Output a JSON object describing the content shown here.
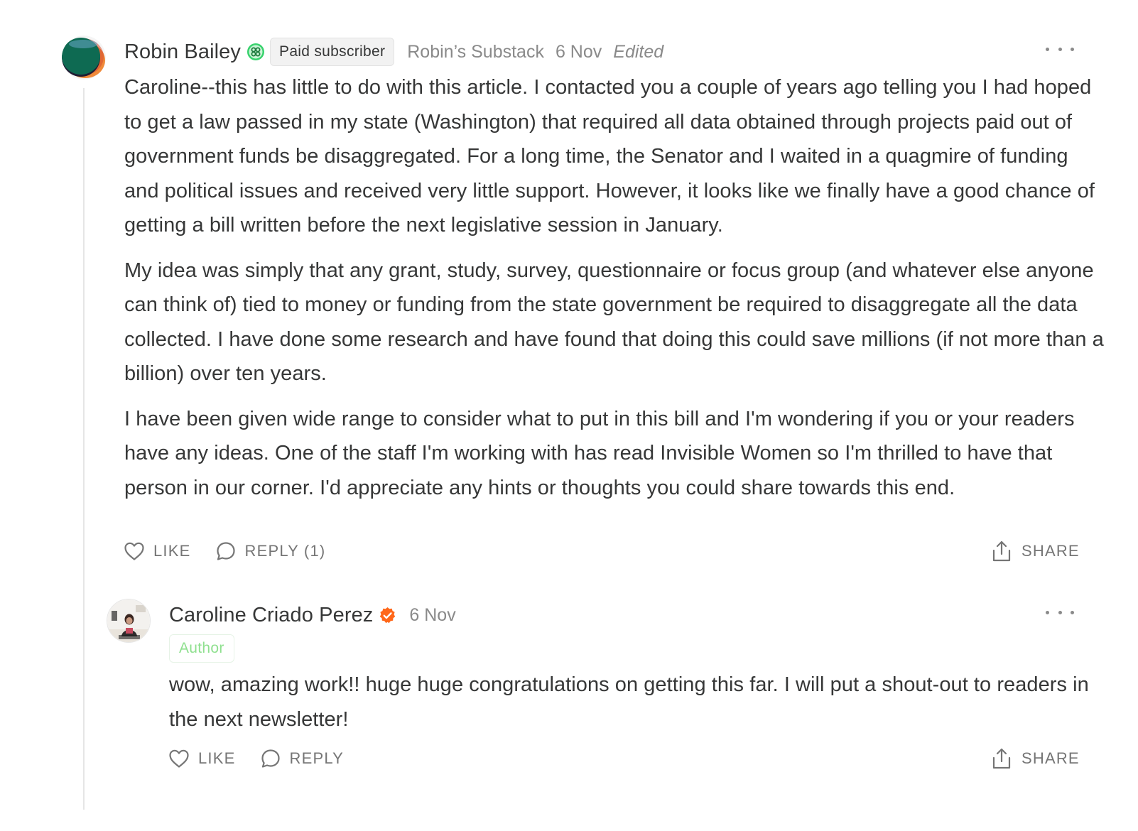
{
  "comment": {
    "author": "Robin Bailey",
    "badge_icon": "paid-subscriber-badge-icon",
    "subscriber_label": "Paid subscriber",
    "publication": "Robin’s Substack",
    "date": "6 Nov",
    "edited_label": "Edited",
    "more_icon": "more-options-icon",
    "paragraphs": [
      "Caroline--this has little to do with this article. I contacted you a couple of years ago telling you I had hoped to get a law passed in my state (Washington) that required all data obtained through projects paid out of government funds be disaggregated. For a long time, the Senator and I waited in a quagmire of funding and political issues and received very little support. However, it looks like we finally have a good chance of getting a bill written before the next legislative session in January.",
      "My idea was simply that any grant, study, survey, questionnaire or focus group (and whatever else anyone can think of) tied to money or funding from the state government be required to disaggregate all the data collected. I have done some research and have found that doing this could save millions (if not more than a billion) over ten years.",
      "I have been given wide range to consider what to put in this bill and I'm wondering if you or your readers have any ideas. One of the staff I'm working with has read Invisible Women so I'm thrilled to have that person in our corner. I'd appreciate any hints or thoughts you could share towards this end."
    ],
    "actions": {
      "like_label": "LIKE",
      "reply_label": "REPLY (1)",
      "share_label": "SHARE"
    }
  },
  "reply": {
    "author": "Caroline Criado Perez",
    "verified_icon": "verified-check-icon",
    "date": "6 Nov",
    "role_label": "Author",
    "more_icon": "more-options-icon",
    "text": "wow, amazing work!! huge huge congratulations on getting this far. I will put a shout-out to readers in the next newsletter!",
    "actions": {
      "like_label": "LIKE",
      "reply_label": "REPLY",
      "share_label": "SHARE"
    }
  },
  "colors": {
    "text": "#363737",
    "muted": "#8a8a8a",
    "action": "#757575",
    "author_badge_green": "#8fe08f",
    "verified_orange": "#ff6719",
    "paid_badge_green": "#38d26d"
  }
}
